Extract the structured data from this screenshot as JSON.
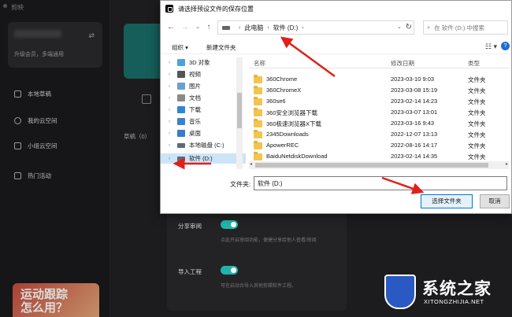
{
  "app": {
    "title": "剪映",
    "user_subtitle": "升级会员，多端通用",
    "nav": [
      {
        "label": "本地草稿"
      },
      {
        "label": "我的云空间"
      },
      {
        "label": "小组云空间"
      },
      {
        "label": "热门活动"
      }
    ],
    "drafts_label": "草稿（0）",
    "promo_text": "运动跟踪\n怎么用？",
    "settings": [
      {
        "label": "分享审阅",
        "desc": "点此开启审阅功能，便捷分享给他人查看/审阅",
        "enabled": true
      },
      {
        "label": "导入工程",
        "desc": "可在启动台导入其他剪辑软件工程。",
        "enabled": true
      }
    ]
  },
  "dialog": {
    "title": "请选择预设文件的保存位置",
    "address": {
      "segments": [
        "此电脑",
        "软件 (D:)"
      ]
    },
    "search_placeholder": "在 软件 (D:) 中搜索",
    "toolbar": {
      "organize": "组织 ▾",
      "new_folder": "新建文件夹"
    },
    "tree": [
      {
        "label": "3D 对象",
        "icon_color": "#4aa3df",
        "icon": "3d-objects-icon"
      },
      {
        "label": "视频",
        "icon_color": "#555555",
        "icon": "video-icon"
      },
      {
        "label": "图片",
        "icon_color": "#6a9fd4",
        "icon": "pictures-icon"
      },
      {
        "label": "文档",
        "icon_color": "#8a8a8a",
        "icon": "documents-icon"
      },
      {
        "label": "下载",
        "icon_color": "#2f86d6",
        "icon": "download-icon"
      },
      {
        "label": "音乐",
        "icon_color": "#3a7fd0",
        "icon": "music-icon"
      },
      {
        "label": "桌面",
        "icon_color": "#3b7ac8",
        "icon": "desktop-icon"
      },
      {
        "label": "本地磁盘 (C:)",
        "icon_color": "#5b6b7a",
        "icon": "drive-icon"
      },
      {
        "label": "软件 (D:)",
        "icon_color": "#5b6b7a",
        "icon": "drive-icon",
        "selected": true
      }
    ],
    "columns": {
      "name": "名称",
      "date": "修改日期",
      "type": "类型"
    },
    "files": [
      {
        "name": "360Chrome",
        "date": "2023-03-10 9:03",
        "type": "文件夹"
      },
      {
        "name": "360ChromeX",
        "date": "2023-03-08 15:19",
        "type": "文件夹"
      },
      {
        "name": "360se6",
        "date": "2023-02-14 14:23",
        "type": "文件夹"
      },
      {
        "name": "360安全浏览器下载",
        "date": "2023-03-07 13:01",
        "type": "文件夹"
      },
      {
        "name": "360极速浏览器X下载",
        "date": "2023-03-16 9:43",
        "type": "文件夹"
      },
      {
        "name": "2345Downloads",
        "date": "2022-12-07 13:13",
        "type": "文件夹"
      },
      {
        "name": "ApowerREC",
        "date": "2022-08-16 14:17",
        "type": "文件夹"
      },
      {
        "name": "BaiduNetdiskDownload",
        "date": "2023-02-14 14:35",
        "type": "文件夹"
      }
    ],
    "folder_label": "文件夹:",
    "folder_value": "软件 (D:)",
    "select_button": "选择文件夹",
    "cancel_button": "取消"
  },
  "watermark": {
    "text": "系统之家",
    "sub": "XITONGZHIJIA.NET"
  },
  "colors": {
    "accent_teal": "#1fb5ad",
    "annotation_red": "#e0201b",
    "selection_blue": "#cce4f7"
  }
}
